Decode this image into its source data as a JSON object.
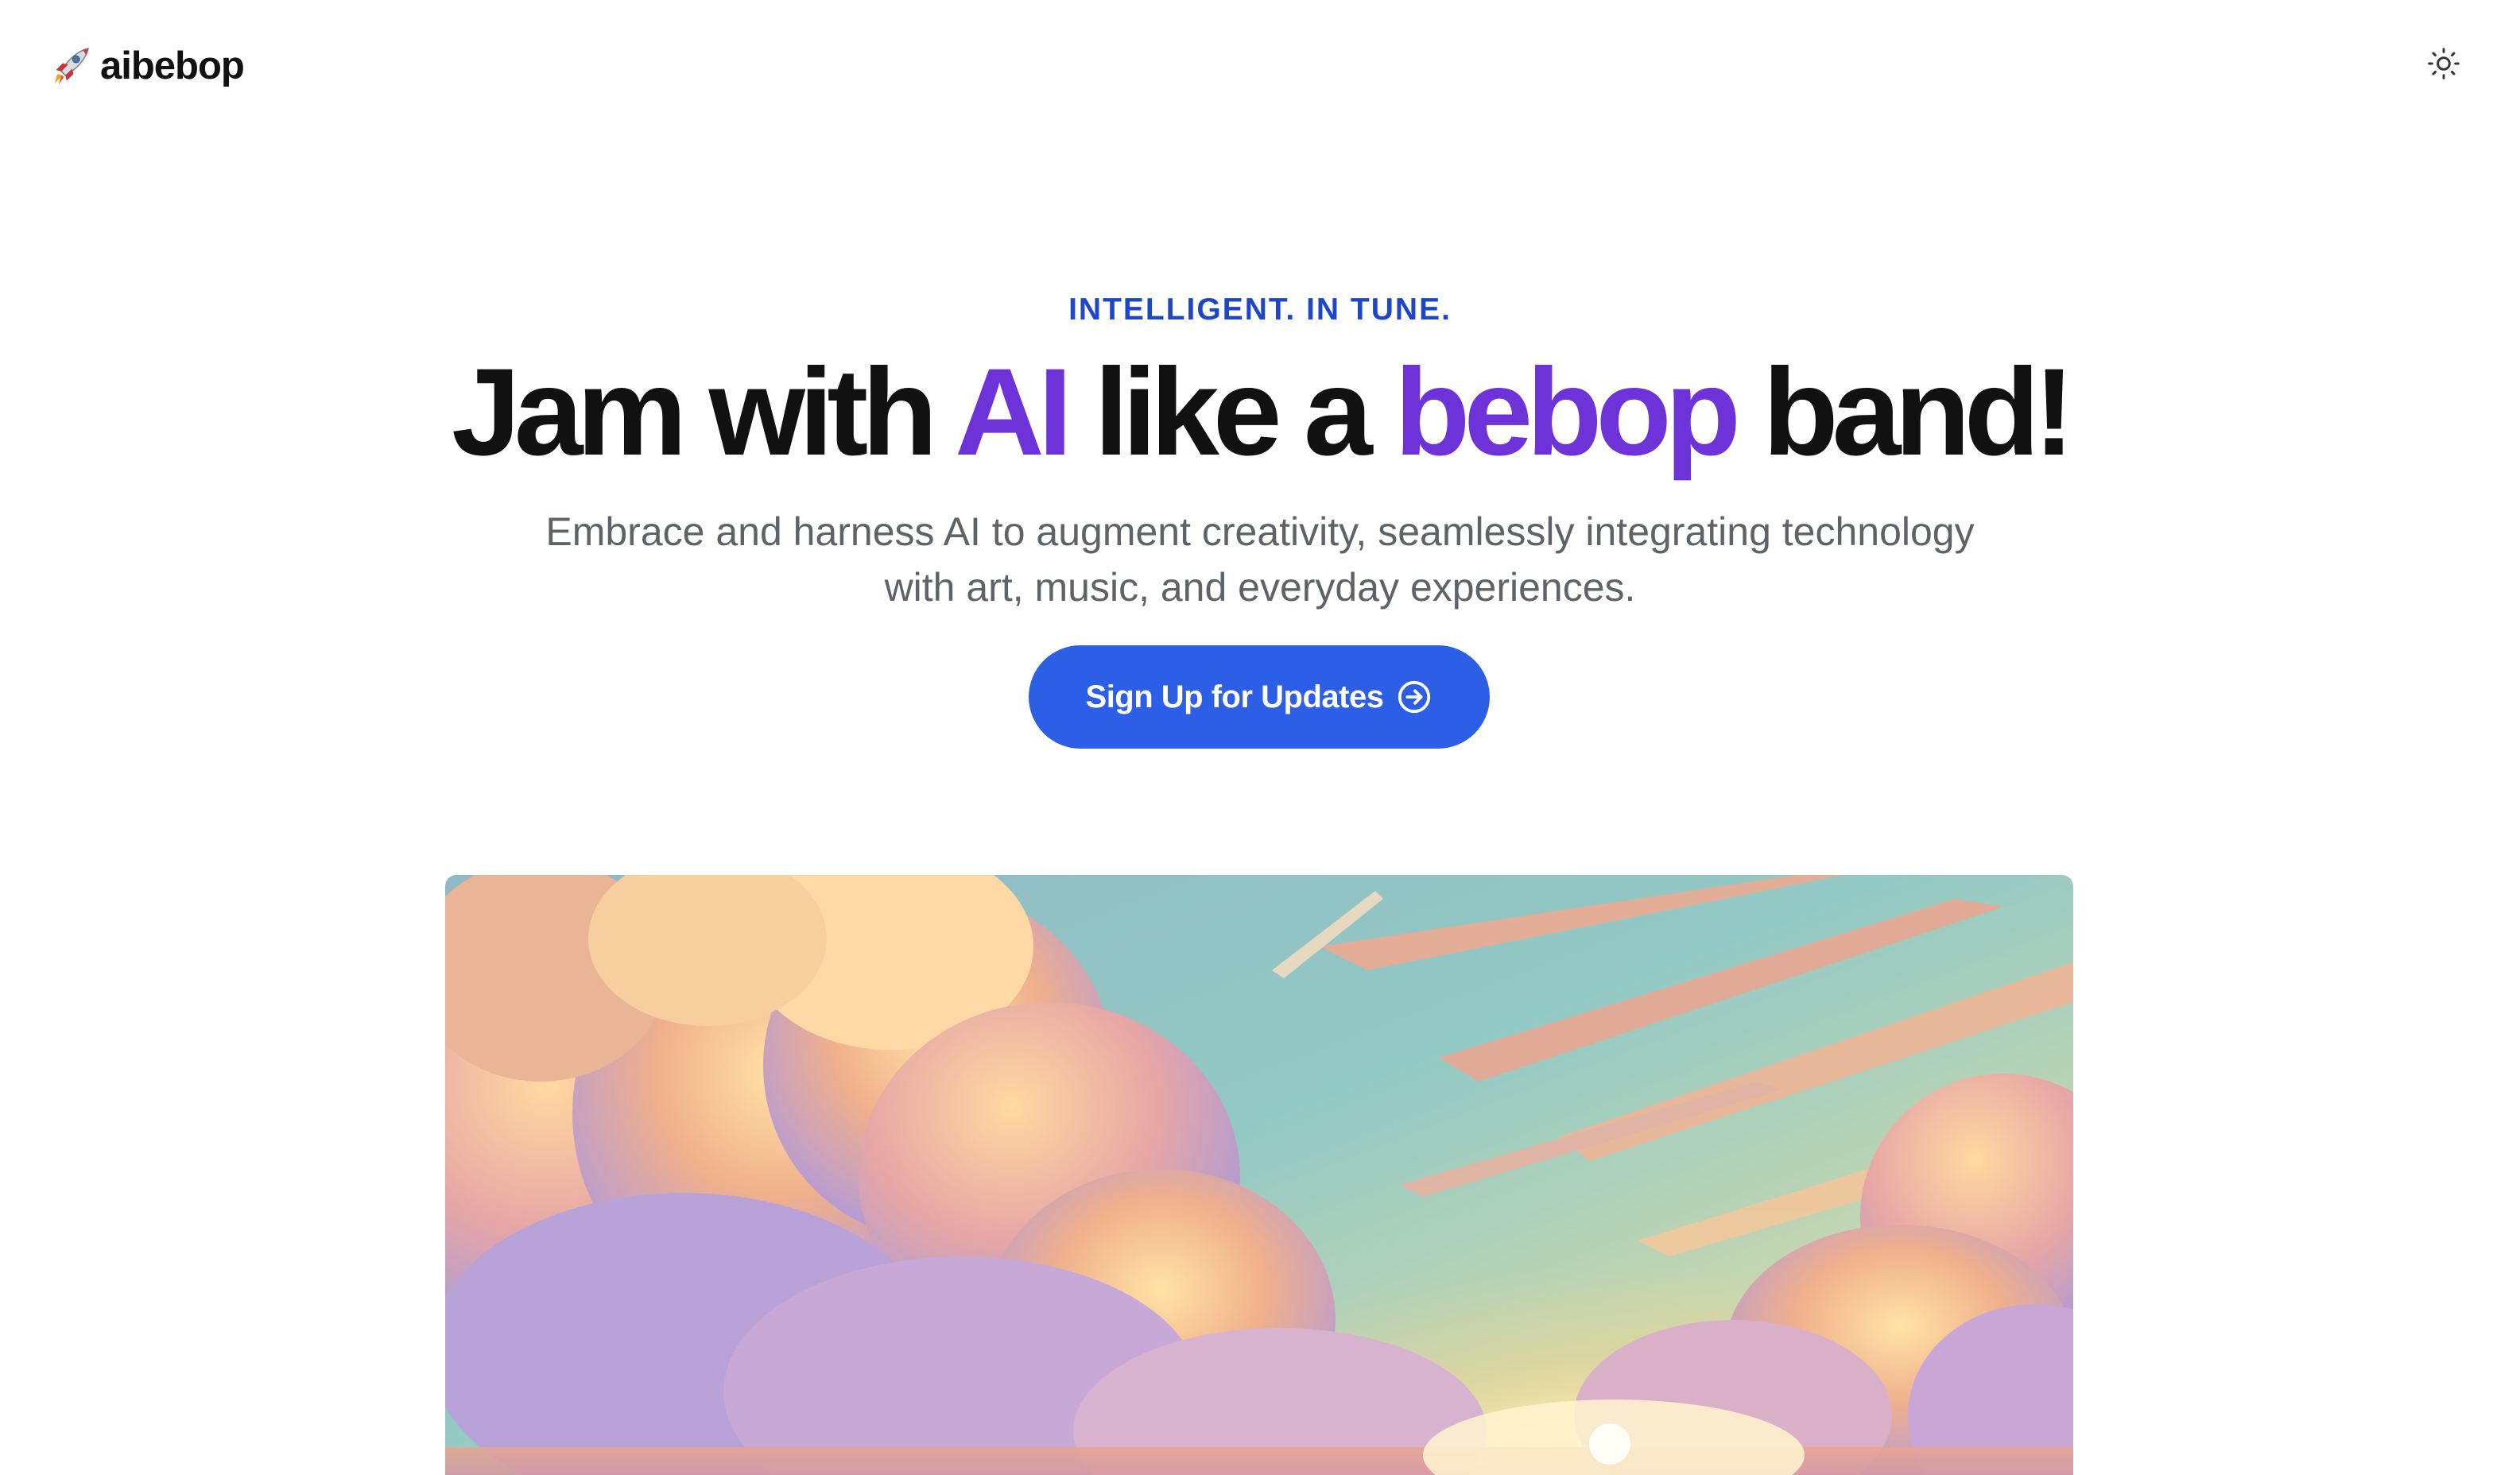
{
  "header": {
    "logo_text": "aibebop",
    "logo_icon": "rocket-icon",
    "theme_toggle_icon": "sun-icon"
  },
  "hero": {
    "eyebrow": "INTELLIGENT. IN TUNE.",
    "headline": {
      "part1": "Jam with ",
      "accent1": "AI",
      "part2": " like a ",
      "accent2": "bebop",
      "part3": " band!"
    },
    "subtitle_line1": "Embrace and harness AI to augment creativity, seamlessly integrating technology",
    "subtitle_line2": "with art, music, and everyday experiences.",
    "cta_label": "Sign Up for Updates",
    "cta_icon": "arrow-right-circle-icon"
  },
  "image": {
    "subject": "painted-sunset-sky-with-clouds"
  },
  "colors": {
    "eyebrow": "#1e46c9",
    "headline": "#111111",
    "accent": "#6d32d8",
    "subtitle": "#5f6368",
    "cta_bg": "#2d5fe6",
    "cta_text": "#ffffff",
    "background": "#ffffff"
  }
}
